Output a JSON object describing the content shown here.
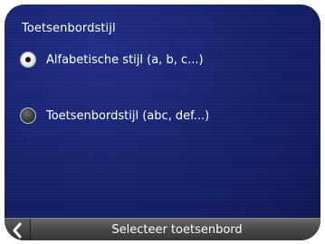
{
  "screen": {
    "title": "Toetsenbordstijl"
  },
  "options": [
    {
      "label": "Alfabetische stijl (a, b, c...)",
      "selected": true
    },
    {
      "label": "Toetsenbordstijl (abc, def...)",
      "selected": false
    }
  ],
  "bottom_bar": {
    "title": "Selecteer toetsenbord",
    "back_icon": "chevron-left-icon"
  },
  "colors": {
    "background": "#15206a",
    "text": "#ffffff",
    "bar": "#4b4b4b"
  }
}
